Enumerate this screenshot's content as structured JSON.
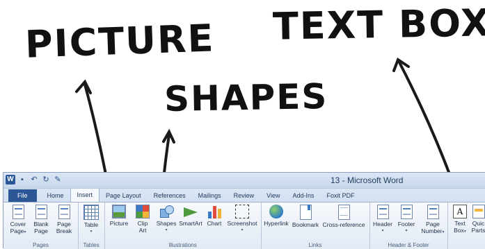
{
  "annotations": {
    "picture": "PICTURE",
    "shapes": "SHAPES",
    "text_box": "TEXT BOX"
  },
  "window": {
    "title": "13 - Microsoft Word",
    "app_icon": "W",
    "qat_icons": [
      "save-icon",
      "undo-icon",
      "redo-icon",
      "format-icon"
    ]
  },
  "tabs": [
    "File",
    "Home",
    "Insert",
    "Page Layout",
    "References",
    "Mailings",
    "Review",
    "View",
    "Add-Ins",
    "Foxit PDF"
  ],
  "active_tab": "Insert",
  "groups": {
    "pages": {
      "label": "Pages",
      "cover": [
        "Cover",
        "Page"
      ],
      "blank": [
        "Blank",
        "Page"
      ],
      "break": [
        "Page",
        "Break"
      ]
    },
    "tables": {
      "label": "Tables",
      "table": "Table"
    },
    "illustrations": {
      "label": "Illustrations",
      "picture": "Picture",
      "clip": [
        "Clip",
        "Art"
      ],
      "shapes": "Shapes",
      "smartart": "SmartArt",
      "chart": "Chart",
      "screenshot": "Screenshot"
    },
    "links": {
      "label": "Links",
      "hyperlink": "Hyperlink",
      "bookmark": "Bookmark",
      "crossref": "Cross-reference"
    },
    "header_footer": {
      "label": "Header & Footer",
      "header": "Header",
      "footer": "Footer",
      "page_number": [
        "Page",
        "Number"
      ]
    },
    "text": {
      "text_box": [
        "Text",
        "Box"
      ],
      "quick_parts": [
        "Quic",
        "Parts"
      ],
      "text_box_glyph": "A"
    }
  },
  "colors": {
    "file_tab": "#2b5797",
    "ribbon": "#f7f9fc",
    "accent": "#4f81bd"
  }
}
